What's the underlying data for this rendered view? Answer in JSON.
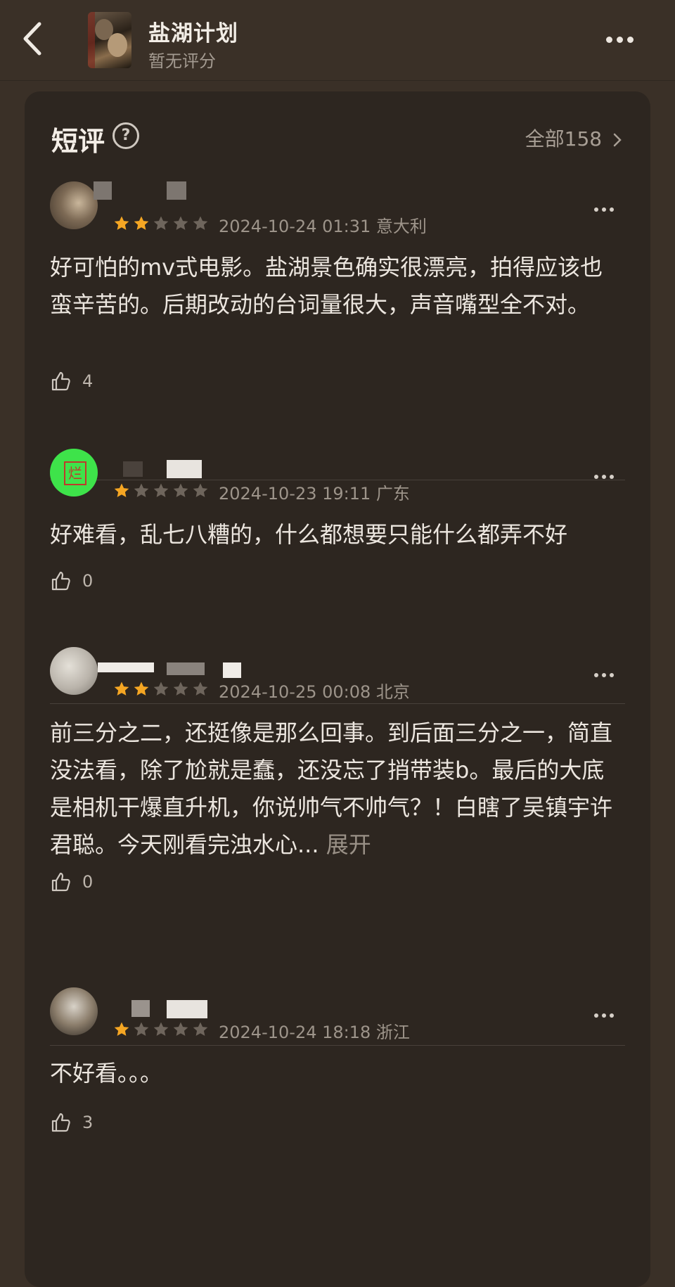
{
  "header": {
    "title": "盐湖计划",
    "subtitle": "暂无评分"
  },
  "section": {
    "title": "短评",
    "all_link": "全部158"
  },
  "reviews": [
    {
      "rating": 2,
      "date": "2024-10-24 01:31 意大利",
      "text": "好可怕的mv式电影。盐湖景色确实很漂亮，拍得应该也蛮辛苦的。后期改动的台词量很大，声音嘴型全不对。",
      "likes": "4"
    },
    {
      "rating": 1,
      "date": "2024-10-23 19:11 广东",
      "text": "好难看，乱七八糟的，什么都想要只能什么都弄不好",
      "likes": "0"
    },
    {
      "rating": 2,
      "date": "2024-10-25 00:08 北京",
      "text": "前三分之二，还挺像是那么回事。到后面三分之一，简直没法看，除了尬就是蠢，还没忘了捎带装b。最后的大底是相机干爆直升机，你说帅气不帅气？！白瞎了吴镇宇许君聪。今天刚看完浊水心...",
      "expand": " 展开",
      "likes": "0"
    },
    {
      "rating": 1,
      "date": "2024-10-24 18:18 浙江",
      "text": "不好看。。。",
      "likes": "3"
    }
  ],
  "colors": {
    "background": "#3a3027",
    "card": "#2d2620",
    "star_active": "#f5a623",
    "star_inactive": "#6e655c"
  },
  "icons": [
    "back-arrow-icon",
    "more-icon",
    "help-icon",
    "chevron-right-icon",
    "thumbs-up-icon",
    "star-icon"
  ]
}
